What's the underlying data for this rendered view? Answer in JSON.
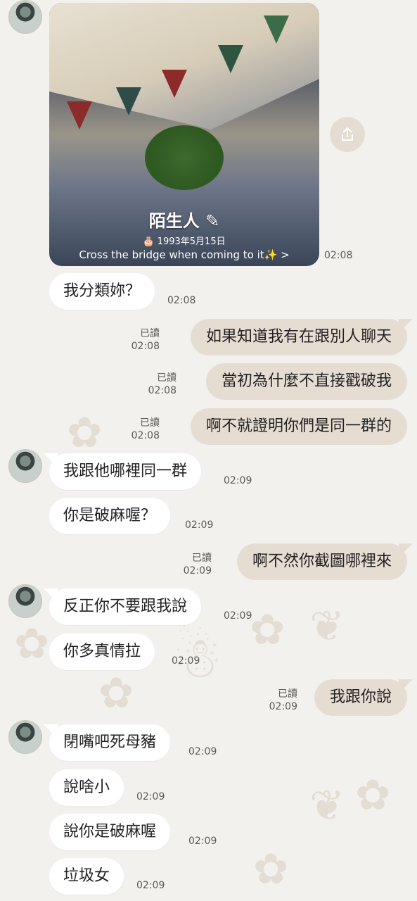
{
  "profile": {
    "name": "陌生人",
    "birthday": "1993年5月15日",
    "status": "Cross the bridge when coming to it✨ >",
    "time": "02:08"
  },
  "read_label": "已讀",
  "messages": [
    {
      "side": "left",
      "text": "我分類妳？",
      "time": "02:08"
    },
    {
      "side": "right",
      "text": "如果知道我有在跟別人聊天",
      "time": "02:08"
    },
    {
      "side": "right",
      "text": "當初為什麼不直接戳破我",
      "time": "02:08"
    },
    {
      "side": "right",
      "text": "啊不就證明你們是同一群的",
      "time": "02:08"
    },
    {
      "side": "left",
      "text": "我跟他哪裡同一群",
      "time": "02:09"
    },
    {
      "side": "left",
      "text": "你是破麻喔？",
      "time": "02:09"
    },
    {
      "side": "right",
      "text": "啊不然你截圖哪裡來",
      "time": "02:09"
    },
    {
      "side": "left",
      "text": "反正你不要跟我說",
      "time": "02:09"
    },
    {
      "side": "left",
      "text": "你多真情拉",
      "time": "02:09"
    },
    {
      "side": "right",
      "text": "我跟你說",
      "time": "02:09"
    },
    {
      "side": "left",
      "text": "閉嘴吧死母豬",
      "time": "02:09"
    },
    {
      "side": "left",
      "text": "說啥小",
      "time": "02:09"
    },
    {
      "side": "left",
      "text": "說你是破麻喔",
      "time": "02:09"
    },
    {
      "side": "left",
      "text": "垃圾女",
      "time": "02:09"
    }
  ]
}
